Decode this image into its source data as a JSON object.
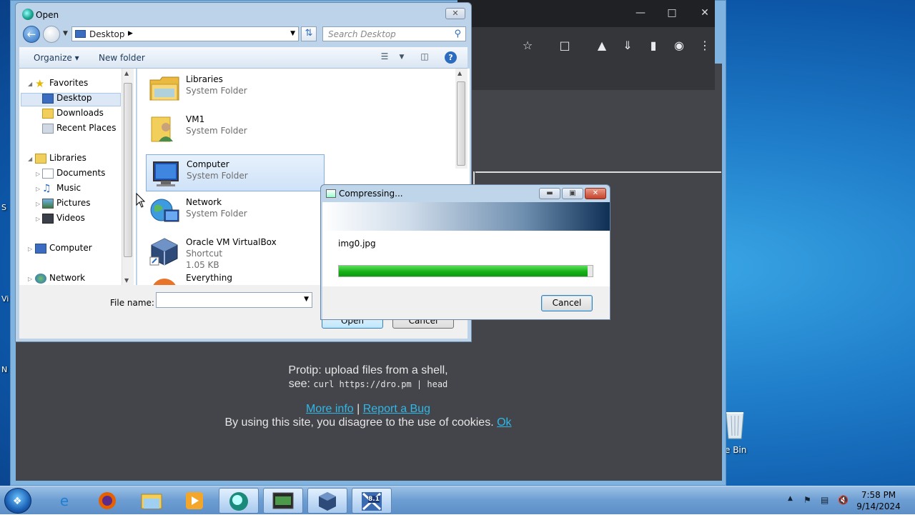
{
  "open_dialog": {
    "title": "Open",
    "address": "Desktop",
    "search_placeholder": "Search Desktop",
    "organize": "Organize",
    "new_folder": "New folder",
    "nav": {
      "favorites": "Favorites",
      "desktop": "Desktop",
      "downloads": "Downloads",
      "recent_places": "Recent Places",
      "libraries": "Libraries",
      "documents": "Documents",
      "music": "Music",
      "pictures": "Pictures",
      "videos": "Videos",
      "computer": "Computer",
      "network": "Network"
    },
    "files": [
      {
        "name": "Libraries",
        "type": "System Folder"
      },
      {
        "name": "VM1",
        "type": "System Folder"
      },
      {
        "name": "Computer",
        "type": "System Folder"
      },
      {
        "name": "Network",
        "type": "System Folder"
      },
      {
        "name": "Oracle VM VirtualBox",
        "type": "Shortcut",
        "size": "1.05 KB"
      },
      {
        "name": "Everything",
        "type": ""
      }
    ],
    "file_name_label": "File name:",
    "file_name_value": "",
    "open_button": "Open",
    "cancel_button": "Cancel"
  },
  "compress_dialog": {
    "title": "Compressing...",
    "file": "img0.jpg",
    "progress": 0.98,
    "cancel": "Cancel"
  },
  "webpage": {
    "protip_line1": "Protip: upload files from a shell,",
    "protip_see": "see:",
    "protip_cmd": "curl https://dro.pm | head",
    "more_info": "More info",
    "separator": "|",
    "report_bug": "Report a Bug",
    "cookies_text": "By using this site, you disagree to the use of cookies.",
    "ok": "Ok"
  },
  "desktop": {
    "recycle_bin_fragment": "e Bin"
  },
  "taskbar": {
    "time": "7:58 PM",
    "date": "9/14/2024",
    "vbox_badge": "8.1"
  }
}
